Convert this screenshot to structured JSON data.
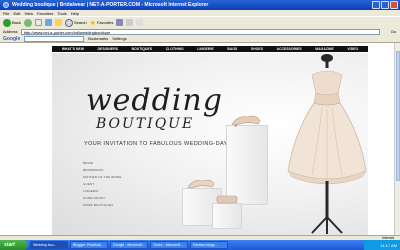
{
  "window": {
    "title": "Wedding boutique | Bridalwear | NET-A-PORTER.COM - Microsoft Internet Explorer"
  },
  "menubar": [
    "File",
    "Edit",
    "View",
    "Favorites",
    "Tools",
    "Help"
  ],
  "toolbar": {
    "back": "Back",
    "search": "Search",
    "favorites": "Favorites"
  },
  "addressbar": {
    "label": "Address",
    "url": "http://www.net-a-porter.com/intl/weddingboutique",
    "go": "Go"
  },
  "googlebar": {
    "logo": "Google",
    "bookmarks": "Bookmarks",
    "settings": "Settings"
  },
  "site_nav": [
    "WHAT'S NEW",
    "DESIGNERS",
    "BOUTIQUES",
    "CLOTHING",
    "LINGERIE",
    "BAGS",
    "SHOES",
    "ACCESSORIES",
    "MAGAZINE",
    "VIDEO"
  ],
  "hero": {
    "title_1": "wedding",
    "title_2": "BOUTIQUE",
    "tagline": "YOUR INVITATION TO FABULOUS WEDDING-DAY CHIC"
  },
  "sublinks": [
    "BRIDE",
    "BRIDESMAID",
    "MOTHER OF THE BRIDE",
    "GUEST",
    "LINGERIE",
    "HONEYMOON",
    "MORE BOUTIQUES"
  ],
  "statusbar": {
    "zone": "Internet"
  },
  "taskbar": {
    "start": "start",
    "tasks": [
      "Wedding bou...",
      "Blogger: Practical...",
      "Google - Microsoft...",
      "Tuxeo - Microsoft...",
      "Fashion blogs..."
    ],
    "clock": "11:17 AM"
  }
}
